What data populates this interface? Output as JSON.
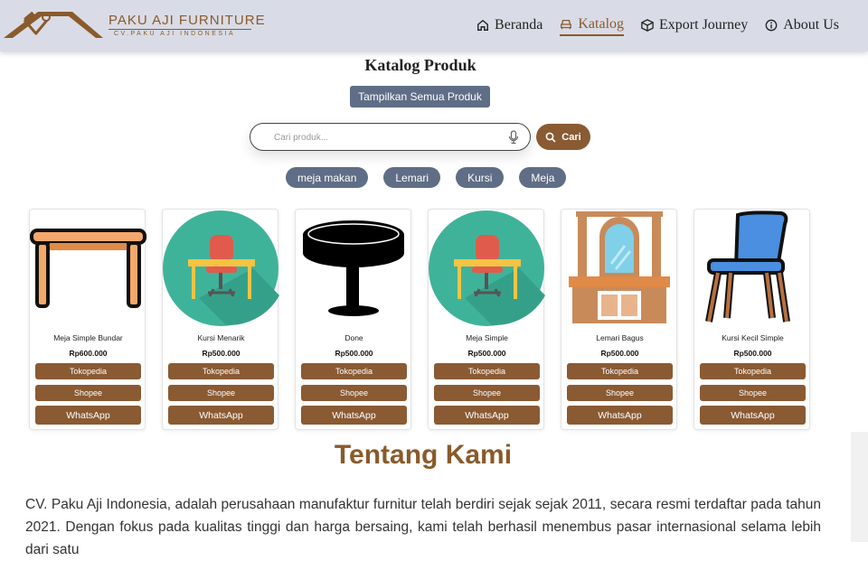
{
  "brand": {
    "name": "PAKU AJI FURNITURE",
    "sub": "CV.PAKU AJI INDONESIA"
  },
  "nav": [
    {
      "label": "Beranda",
      "icon": "home-icon"
    },
    {
      "label": "Katalog",
      "icon": "sofa-icon",
      "active": true
    },
    {
      "label": "Export Journey",
      "icon": "box-icon"
    },
    {
      "label": "About Us",
      "icon": "info-icon"
    }
  ],
  "catalog": {
    "title": "Katalog Produk",
    "show_all": "Tampilkan Semua Produk",
    "search_placeholder": "Cari produk...",
    "search_button": "Cari",
    "chips": [
      "meja makan",
      "Lemari",
      "Kursi",
      "Meja"
    ]
  },
  "products": [
    {
      "name": "Meja Simple Bundar",
      "price": "Rp600.000",
      "image": "table-icon",
      "tokopedia": "Tokopedia",
      "shopee": "Shopee",
      "whatsapp": "WhatsApp"
    },
    {
      "name": "Kursi Menarik",
      "price": "Rp500.000",
      "image": "desk-chair-icon",
      "tokopedia": "Tokopedia",
      "shopee": "Shopee",
      "whatsapp": "WhatsApp"
    },
    {
      "name": "Done",
      "price": "Rp500.000",
      "image": "round-table-icon",
      "tokopedia": "Tokopedia",
      "shopee": "Shopee",
      "whatsapp": "WhatsApp"
    },
    {
      "name": "Meja Simple",
      "price": "Rp500.000",
      "image": "desk-chair-icon",
      "tokopedia": "Tokopedia",
      "shopee": "Shopee",
      "whatsapp": "WhatsApp"
    },
    {
      "name": "Lemari Bagus",
      "price": "Rp500.000",
      "image": "wardrobe-icon",
      "tokopedia": "Tokopedia",
      "shopee": "Shopee",
      "whatsapp": "WhatsApp"
    },
    {
      "name": "Kursi Kecil Simple",
      "price": "Rp500.000",
      "image": "chair-icon",
      "tokopedia": "Tokopedia",
      "shopee": "Shopee",
      "whatsapp": "WhatsApp"
    }
  ],
  "about": {
    "title": "Tentang Kami",
    "text": "CV. Paku Aji Indonesia, adalah perusahaan manufaktur furnitur telah berdiri sejak sejak 2011, secara resmi terdaftar pada tahun 2021. Dengan fokus pada kualitas tinggi dan harga bersaing, kami telah berhasil menembus pasar internasional selama lebih dari satu"
  },
  "colors": {
    "accent": "#8a5a33",
    "slate": "#5f6d86",
    "navbar": "#d9dce6"
  }
}
